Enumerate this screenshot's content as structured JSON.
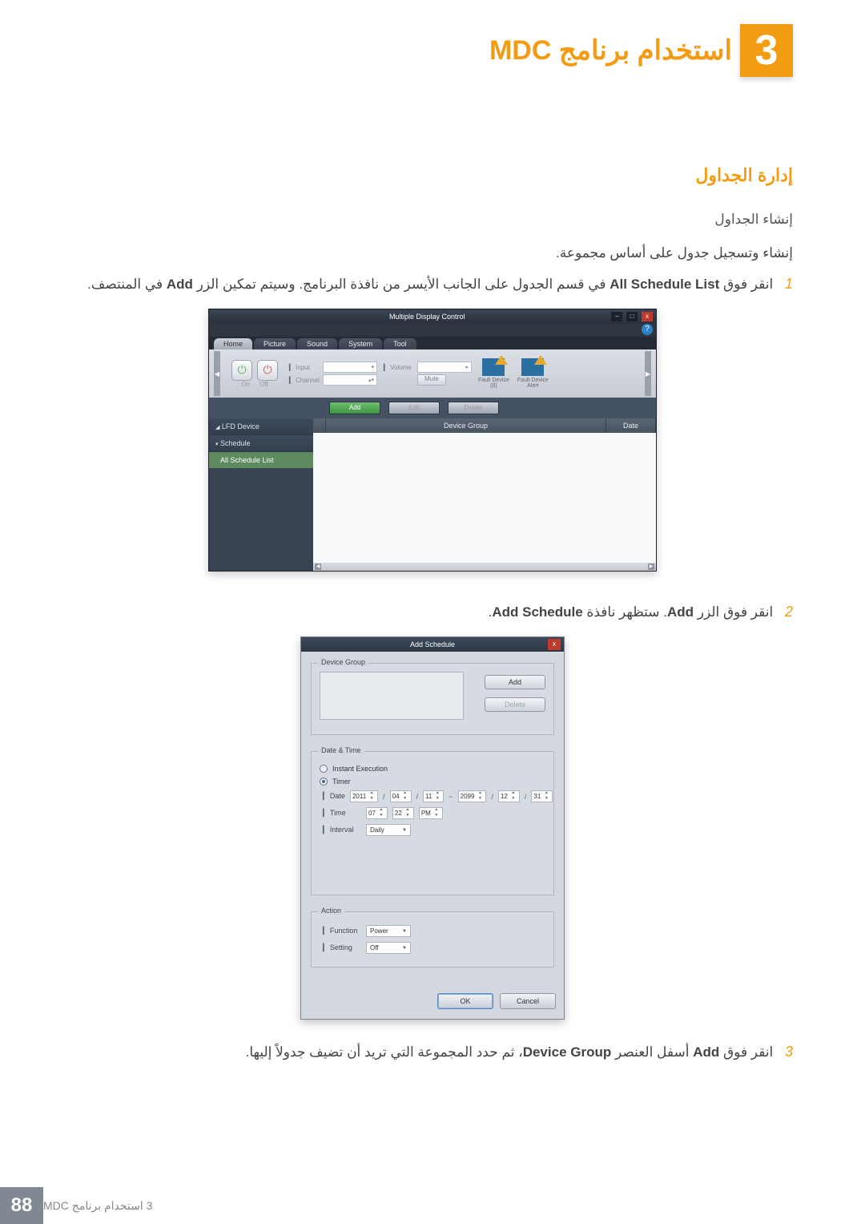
{
  "chapter": {
    "number": "3",
    "title": "استخدام برنامج MDC"
  },
  "section_heading": "إدارة الجداول",
  "sub_heading": "إنشاء الجداول",
  "intro_line": "إنشاء وتسجيل جدول على أساس مجموعة.",
  "step1": {
    "num": "1",
    "text_parts": [
      "انقر فوق ",
      "All Schedule List",
      " في قسم الجدول على الجانب الأيسر من نافذة البرنامج. وسيتم تمكين الزر ",
      "Add",
      " في المنتصف."
    ]
  },
  "step2": {
    "num": "2",
    "text_parts": [
      "انقر فوق الزر ",
      "Add",
      ". ستظهر نافذة ",
      "Add Schedule",
      "."
    ]
  },
  "step3": {
    "num": "3",
    "text_parts": [
      "انقر فوق ",
      "Add",
      " أسفل العنصر ",
      "Device Group",
      "، ثم حدد المجموعة التي تريد أن تضيف جدولاً إليها."
    ]
  },
  "mdc": {
    "title": "Multiple Display Control",
    "winbtns": {
      "min": "–",
      "max": "□",
      "close": "x"
    },
    "help": "?",
    "tabs": [
      "Home",
      "Picture",
      "Sound",
      "System",
      "Tool"
    ],
    "power": {
      "on": "On",
      "off": "Off"
    },
    "inputs": {
      "input_label": "Input",
      "channel_label": "Channel",
      "volume_label": "Volume",
      "mute_label": "Mute"
    },
    "fault": {
      "count_label": "Fault Device",
      "count_value": "(0)",
      "alert_label": "Fault Device",
      "alert_value": "Alert"
    },
    "actions": {
      "add": "Add",
      "edit": "Edit",
      "delete": "Delete"
    },
    "sidebar": {
      "lfd": "LFD Device",
      "schedule": "Schedule",
      "all_schedule": "All Schedule List"
    },
    "grid": {
      "device_group": "Device Group",
      "date": "Date"
    }
  },
  "dlg": {
    "title": "Add Schedule",
    "close": "x",
    "device_group_legend": "Device Group",
    "add_btn": "Add",
    "delete_btn": "Delete",
    "datetime_legend": "Date & Time",
    "instant": "Instant Execution",
    "timer": "Timer",
    "date_label": "Date",
    "date": {
      "y1": "2011",
      "m1": "04",
      "d1": "11",
      "tilde": "~",
      "y2": "2099",
      "m2": "12",
      "d2": "31"
    },
    "time_label": "Time",
    "time": {
      "hh": "07",
      "mm": "22",
      "ap": "PM"
    },
    "interval_label": "Interval",
    "interval_value": "Daily",
    "action_legend": "Action",
    "function_label": "Function",
    "function_value": "Power",
    "setting_label": "Setting",
    "setting_value": "Off",
    "ok": "OK",
    "cancel": "Cancel"
  },
  "footer": {
    "text": "3 استخدام برنامج MDC",
    "page": "88"
  }
}
